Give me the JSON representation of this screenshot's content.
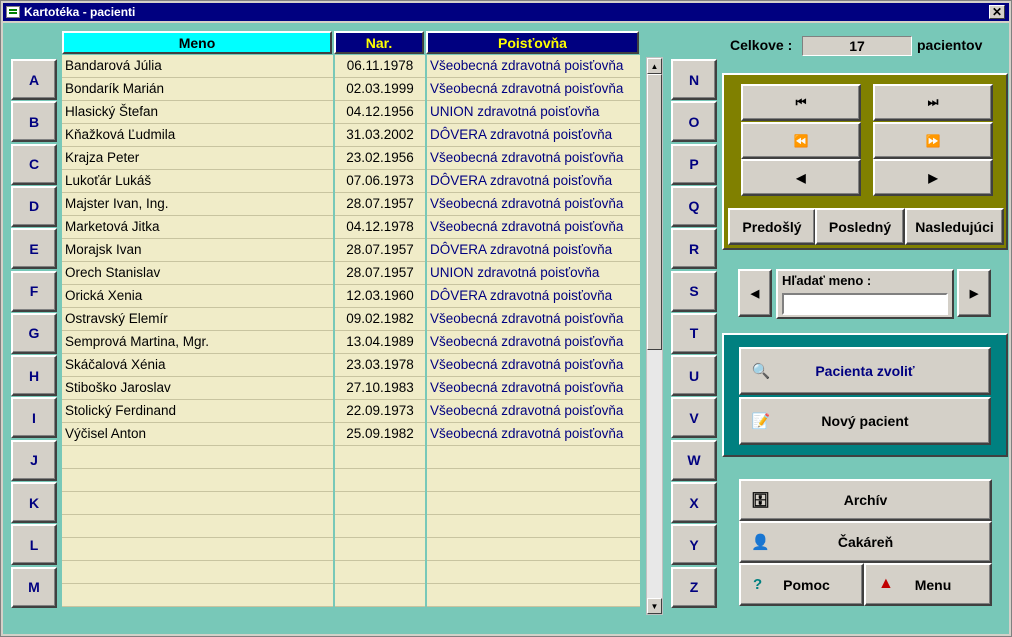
{
  "window": {
    "title": "Kartotéka - pacienti",
    "close_label": "✕"
  },
  "letters_left": [
    "A",
    "B",
    "C",
    "D",
    "E",
    "F",
    "G",
    "H",
    "I",
    "J",
    "K",
    "L",
    "M"
  ],
  "letters_right": [
    "N",
    "O",
    "P",
    "Q",
    "R",
    "S",
    "T",
    "U",
    "V",
    "W",
    "X",
    "Y",
    "Z"
  ],
  "table": {
    "headers": {
      "meno": "Meno",
      "nar": "Nar.",
      "poistovna": "Poisťovňa"
    },
    "rows": [
      {
        "meno": "Bandarová Júlia",
        "nar": "06.11.1978",
        "poistovna": "Všeobecná zdravotná poisťovňa"
      },
      {
        "meno": "Bondarík Marián",
        "nar": "02.03.1999",
        "poistovna": "Všeobecná zdravotná poisťovňa"
      },
      {
        "meno": "Hlasický Štefan",
        "nar": "04.12.1956",
        "poistovna": "UNION zdravotná poisťovňa"
      },
      {
        "meno": "Kňažková Ľudmila",
        "nar": "31.03.2002",
        "poistovna": "DÔVERA zdravotná poisťovňa"
      },
      {
        "meno": "Krajza Peter",
        "nar": "23.02.1956",
        "poistovna": "Všeobecná zdravotná poisťovňa"
      },
      {
        "meno": "Lukoťár Lukáš",
        "nar": "07.06.1973",
        "poistovna": "DÔVERA zdravotná poisťovňa"
      },
      {
        "meno": "Majster Ivan, Ing.",
        "nar": "28.07.1957",
        "poistovna": "Všeobecná zdravotná poisťovňa"
      },
      {
        "meno": "Marketová Jitka",
        "nar": "04.12.1978",
        "poistovna": "Všeobecná zdravotná poisťovňa"
      },
      {
        "meno": "Morajsk Ivan",
        "nar": "28.07.1957",
        "poistovna": "DÔVERA zdravotná poisťovňa"
      },
      {
        "meno": "Orech Stanislav",
        "nar": "28.07.1957",
        "poistovna": "UNION zdravotná poisťovňa"
      },
      {
        "meno": "Orická Xenia",
        "nar": "12.03.1960",
        "poistovna": "DÔVERA zdravotná poisťovňa"
      },
      {
        "meno": "Ostravský Elemír",
        "nar": "09.02.1982",
        "poistovna": "Všeobecná zdravotná poisťovňa"
      },
      {
        "meno": "Semprová Martina, Mgr.",
        "nar": "13.04.1989",
        "poistovna": "Všeobecná zdravotná poisťovňa"
      },
      {
        "meno": "Skáčalová Xénia",
        "nar": "23.03.1978",
        "poistovna": "Všeobecná zdravotná poisťovňa"
      },
      {
        "meno": "Stiboško Jaroslav",
        "nar": "27.10.1983",
        "poistovna": "Všeobecná zdravotná poisťovňa"
      },
      {
        "meno": "Stolický Ferdinand",
        "nar": "22.09.1973",
        "poistovna": "Všeobecná zdravotná poisťovňa"
      },
      {
        "meno": "Výčisel Anton",
        "nar": "25.09.1982",
        "poistovna": "Všeobecná zdravotná poisťovňa"
      },
      {
        "meno": "",
        "nar": "",
        "poistovna": ""
      },
      {
        "meno": "",
        "nar": "",
        "poistovna": ""
      },
      {
        "meno": "",
        "nar": "",
        "poistovna": ""
      },
      {
        "meno": "",
        "nar": "",
        "poistovna": ""
      },
      {
        "meno": "",
        "nar": "",
        "poistovna": ""
      },
      {
        "meno": "",
        "nar": "",
        "poistovna": ""
      },
      {
        "meno": "",
        "nar": "",
        "poistovna": ""
      }
    ]
  },
  "summary": {
    "label": "Celkove :",
    "count": "17",
    "unit": "pacientov"
  },
  "nav": {
    "first": "⏮",
    "last": "⏭",
    "prev_page": "⏪",
    "next_page": "⏩",
    "prev": "◀",
    "next": "▶",
    "predosly": "Predošlý",
    "posledny": "Posledný",
    "nasledujuci": "Nasledujúci"
  },
  "search": {
    "label": "Hľadať meno :",
    "value": "",
    "prev": "◀",
    "next": "▶"
  },
  "actions": {
    "zvolit": "Pacienta zvoliť",
    "novy": "Nový pacient",
    "archiv": "Archív",
    "cakaren": "Čakáreň",
    "pomoc": "Pomoc",
    "menu": "Menu"
  },
  "icons": {
    "zvolit": "🔍",
    "novy": "📝",
    "archiv": "🗄",
    "cakaren": "👤",
    "pomoc": "?",
    "menu": "▲"
  }
}
